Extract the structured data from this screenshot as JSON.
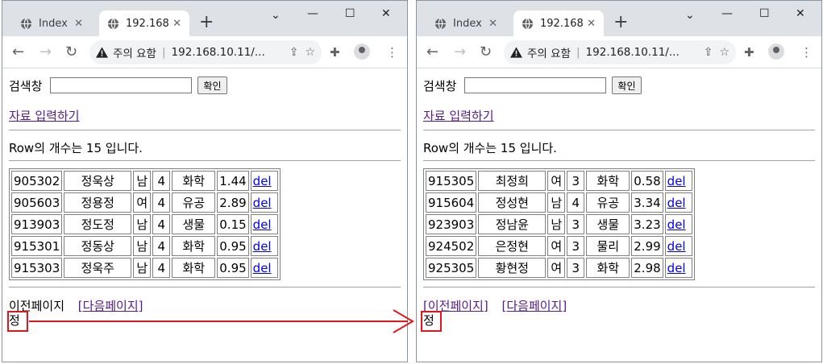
{
  "browser": {
    "tab_inactive_title": "Index of",
    "tab_active_title": "192.168.",
    "security_label": "주의 요함",
    "url": "192.168.10.11/..."
  },
  "page": {
    "search_label": "검색창",
    "search_value": "",
    "search_button": "확인",
    "input_link": "자료 입력하기",
    "prev_page": "이전페이지",
    "prev_page_link": "[이전페이지]",
    "next_page_link": "[다음페이지]",
    "row_count_text": "Row의 개수는 15 입니다.",
    "search_char": "정"
  },
  "left_window": {
    "rows": [
      {
        "id": "905302",
        "name": "정욱상",
        "sex": "남",
        "year": "4",
        "dept": "화학",
        "gpa": "1.44",
        "action": "del"
      },
      {
        "id": "905603",
        "name": "정용정",
        "sex": "여",
        "year": "4",
        "dept": "유공",
        "gpa": "2.89",
        "action": "del"
      },
      {
        "id": "913903",
        "name": "정도정",
        "sex": "남",
        "year": "4",
        "dept": "생물",
        "gpa": "0.15",
        "action": "del"
      },
      {
        "id": "915301",
        "name": "정동상",
        "sex": "남",
        "year": "4",
        "dept": "화학",
        "gpa": "0.95",
        "action": "del"
      },
      {
        "id": "915303",
        "name": "정욱주",
        "sex": "남",
        "year": "4",
        "dept": "화학",
        "gpa": "0.95",
        "action": "del"
      }
    ]
  },
  "right_window": {
    "rows": [
      {
        "id": "915305",
        "name": "최정희",
        "sex": "여",
        "year": "3",
        "dept": "화학",
        "gpa": "0.58",
        "action": "del"
      },
      {
        "id": "915604",
        "name": "정성현",
        "sex": "남",
        "year": "4",
        "dept": "유공",
        "gpa": "3.34",
        "action": "del"
      },
      {
        "id": "923903",
        "name": "정남윤",
        "sex": "남",
        "year": "3",
        "dept": "생물",
        "gpa": "3.23",
        "action": "del"
      },
      {
        "id": "924502",
        "name": "은정현",
        "sex": "여",
        "year": "3",
        "dept": "물리",
        "gpa": "2.99",
        "action": "del"
      },
      {
        "id": "925305",
        "name": "황현정",
        "sex": "여",
        "year": "3",
        "dept": "화학",
        "gpa": "2.98",
        "action": "del"
      }
    ]
  },
  "colors": {
    "highlight": "#e0161d",
    "tab_strip": "#dee1e6",
    "visited_link": "#551a8b",
    "link": "#0000ee"
  }
}
